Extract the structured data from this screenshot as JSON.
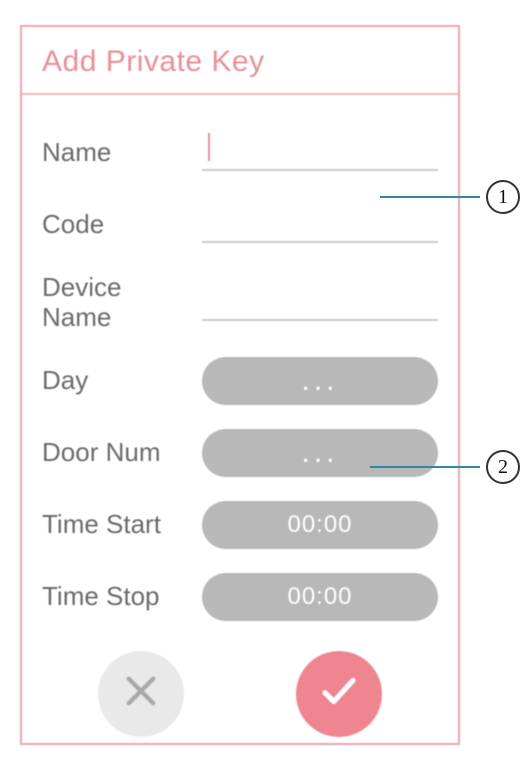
{
  "title": "Add Private Key",
  "fields": {
    "name": {
      "label": "Name",
      "value": ""
    },
    "code": {
      "label": "Code",
      "value": ""
    },
    "device_name": {
      "label": "Device\nName",
      "value": ""
    },
    "day": {
      "label": "Day",
      "value": "..."
    },
    "door_num": {
      "label": "Door Num",
      "value": "..."
    },
    "time_start": {
      "label": "Time Start",
      "value": "00:00"
    },
    "time_stop": {
      "label": "Time Stop",
      "value": "00:00"
    }
  },
  "annotations": {
    "callout1": "1",
    "callout2": "2"
  },
  "colors": {
    "accent": "#ec8e96",
    "border": "#eda5a9",
    "pill": "#b8b8b8",
    "cancel_bg": "#e9e9e9",
    "callout_line": "#2e8aa3"
  }
}
